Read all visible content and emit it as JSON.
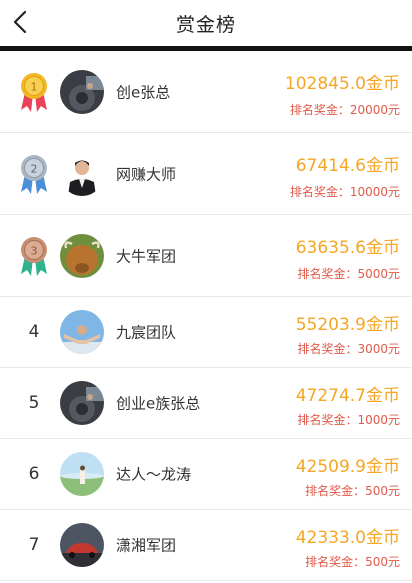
{
  "header": {
    "title": "赏金榜",
    "back_icon": "back-arrow-icon"
  },
  "colors": {
    "coins": "#f5a623",
    "prize": "#e05a4a",
    "gold": "#f2b722",
    "silver": "#aab6c2",
    "bronze": "#c98f74"
  },
  "leaderboard": [
    {
      "rank": "1",
      "name": "创e张总",
      "coins": "102845.0金币",
      "prize": "排名奖金：20000元",
      "badge": "gold-medal-icon"
    },
    {
      "rank": "2",
      "name": "网赚大师",
      "coins": "67414.6金币",
      "prize": "排名奖金：10000元",
      "badge": "silver-medal-icon"
    },
    {
      "rank": "3",
      "name": "大牛军团",
      "coins": "63635.6金币",
      "prize": "排名奖金：5000元",
      "badge": "bronze-medal-icon"
    },
    {
      "rank": "4",
      "name": "九宸团队",
      "coins": "55203.9金币",
      "prize": "排名奖金：3000元"
    },
    {
      "rank": "5",
      "name": "创业e族张总",
      "coins": "47274.7金币",
      "prize": "排名奖金：1000元"
    },
    {
      "rank": "6",
      "name": "达人～龙涛",
      "coins": "42509.9金币",
      "prize": "排名奖金：500元"
    },
    {
      "rank": "7",
      "name": "潇湘军团",
      "coins": "42333.0金币",
      "prize": "排名奖金：500元"
    }
  ]
}
